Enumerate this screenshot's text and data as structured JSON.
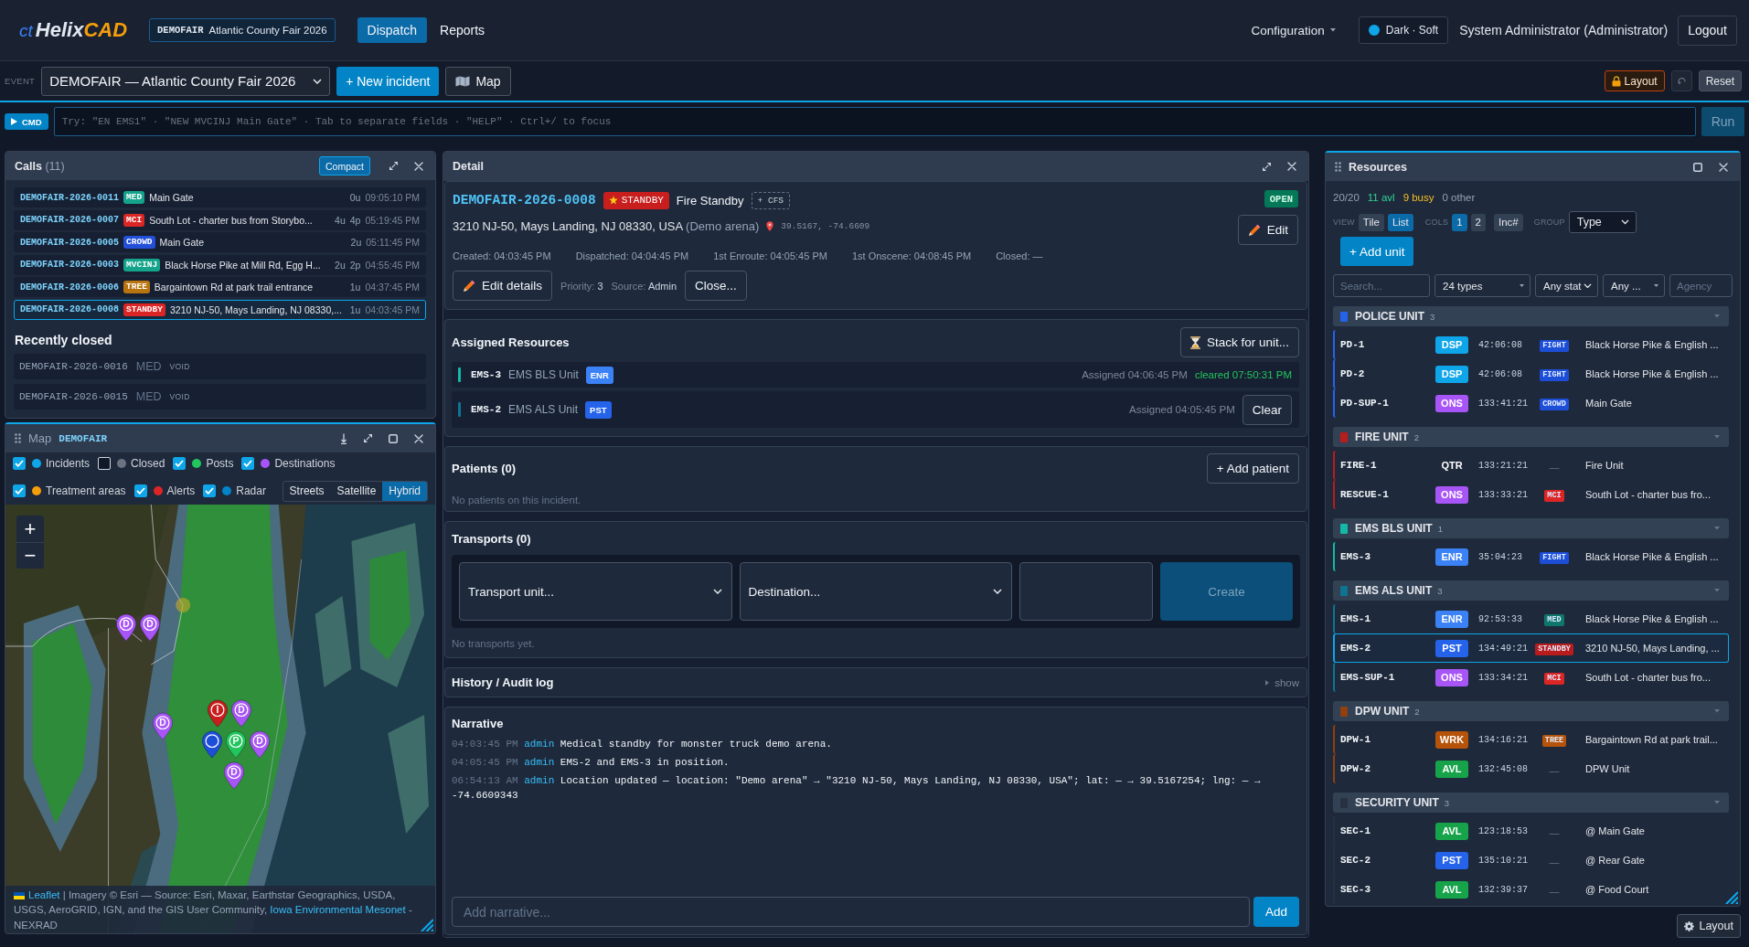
{
  "top_bar": {
    "logo": {
      "prefix": "ct",
      "name": "Helix",
      "suffix": "CAD"
    },
    "event_chip": {
      "code": "DEMOFAIR",
      "name": "Atlantic County Fair 2026"
    },
    "tabs": [
      {
        "label": "Dispatch",
        "selected": true
      },
      {
        "label": "Reports",
        "selected": false
      }
    ],
    "config_menu": "Configuration",
    "theme_toggle": "Dark · Soft",
    "user": "System Administrator (Administrator)",
    "logout": "Logout"
  },
  "event_bar": {
    "label": "EVENT",
    "event_select": "DEMOFAIR — Atlantic County Fair 2026",
    "new_incident": "+ New incident",
    "map": "Map",
    "layout": "Layout",
    "reset": "Reset"
  },
  "command_bar": {
    "button": "CMD",
    "placeholder": "Try: \"EN EMS1\" · \"NEW MVCINJ Main Gate\" · Tab to separate fields · \"HELP\" · Ctrl+/ to focus",
    "run": "Run"
  },
  "calls": {
    "title": "Calls",
    "count": "(11)",
    "compact": "Compact",
    "rows": [
      {
        "id": "DEMOFAIR-2026-0011",
        "type": {
          "label": "MED",
          "color": "#14a38b"
        },
        "location": "Main Gate",
        "units": "0u",
        "time": "09:05:10 PM",
        "selected": false
      },
      {
        "id": "DEMOFAIR-2026-0007",
        "type": {
          "label": "MCI",
          "color": "#dc2626"
        },
        "location": "South Lot - charter bus from Storybo...",
        "units": "4u",
        "patients": "4p",
        "time": "05:19:45 PM",
        "selected": false
      },
      {
        "id": "DEMOFAIR-2026-0005",
        "type": {
          "label": "CROWD",
          "color": "#2350d8"
        },
        "location": "Main Gate",
        "units": "2u",
        "time": "05:11:45 PM",
        "selected": false
      },
      {
        "id": "DEMOFAIR-2026-0003",
        "type": {
          "label": "MVCINJ",
          "color": "#14a38b"
        },
        "location": "Black Horse Pike at Mill Rd, Egg H...",
        "units": "2u",
        "patients": "2p",
        "time": "04:55:45 PM",
        "selected": false
      },
      {
        "id": "DEMOFAIR-2026-0006",
        "type": {
          "label": "TREE",
          "color": "#b8740f"
        },
        "location": "Bargaintown Rd at park trail entrance",
        "units": "1u",
        "time": "04:37:45 PM",
        "selected": false
      },
      {
        "id": "DEMOFAIR-2026-0008",
        "type": {
          "label": "STANDBY",
          "color": "#dc2626"
        },
        "location": "3210 NJ-50, Mays Landing, NJ 08330,...",
        "units": "1u",
        "time": "04:03:45 PM",
        "selected": true
      }
    ],
    "closed_title": "Recently closed",
    "closed": [
      {
        "id": "DEMOFAIR-2026-0016",
        "type": "MED",
        "status": "VOID"
      },
      {
        "id": "DEMOFAIR-2026-0015",
        "type": "MED",
        "status": "VOID"
      }
    ]
  },
  "map": {
    "title": "Map",
    "event": "DEMOFAIR",
    "layer_rows": [
      [
        {
          "label": "Incidents",
          "checked": true,
          "color": "#0ea5e9"
        },
        {
          "label": "Closed",
          "checked": false,
          "color": "#6b7280"
        },
        {
          "label": "Posts",
          "checked": true,
          "color": "#22c55e"
        },
        {
          "label": "Destinations",
          "checked": true,
          "color": "#a855f7"
        }
      ],
      [
        {
          "label": "Treatment areas",
          "checked": true,
          "color": "#f59e0b"
        },
        {
          "label": "Alerts",
          "checked": true,
          "color": "#dc2626"
        },
        {
          "label": "Radar",
          "checked": true,
          "color": "#0284c7"
        }
      ]
    ],
    "base_layers": [
      {
        "label": "Streets",
        "selected": false
      },
      {
        "label": "Satellite",
        "selected": false
      },
      {
        "label": "Hybrid",
        "selected": true
      }
    ],
    "zoom_in": "+",
    "zoom_out": "−",
    "markers": [
      {
        "label": "D",
        "color": "#a855f7"
      },
      {
        "label": "D",
        "color": "#a855f7"
      },
      {
        "label": "D",
        "color": "#a855f7"
      },
      {
        "label": "D",
        "color": "#a855f7"
      },
      {
        "label": "I",
        "color": "#c81e1e"
      },
      {
        "color": "#1d4ed8"
      },
      {
        "label": "P",
        "color": "#22c55e"
      },
      {
        "label": "D",
        "color": "#a855f7"
      },
      {
        "label": "D",
        "color": "#a855f7"
      }
    ],
    "attribution": {
      "leaflet": "Leaflet",
      "text": "| Imagery © Esri — Source: Esri, Maxar, Earthstar Geographics, USDA, USGS, AeroGRID, IGN, and the GIS User Community,",
      "source": "Iowa Environmental Mesonet",
      "suffix": "- NEXRAD"
    }
  },
  "detail": {
    "title": "Detail",
    "incident": {
      "id": "DEMOFAIR-2026-0008",
      "type": "STANDBY",
      "name": "Fire Standby",
      "cfs": "+ CFS",
      "status": "OPEN",
      "address": "3210 NJ-50, Mays Landing, NJ 08330, USA",
      "place": "(Demo arena)",
      "coords": "39.5167, -74.6609"
    },
    "edit": "Edit",
    "times": [
      "Created: 04:03:45 PM",
      "Dispatched: 04:04:45 PM",
      "1st Enroute: 04:05:45 PM",
      "1st Onscene: 04:08:45 PM",
      "Closed: —"
    ],
    "edit_details": "Edit details",
    "meta": [
      {
        "label": "Priority:",
        "value": "3"
      },
      {
        "label": "Source:",
        "value": "Admin"
      }
    ],
    "close": "Close...",
    "assigned": {
      "title": "Assigned Resources",
      "stack": "Stack for unit...",
      "rows": [
        {
          "unit": "EMS-3",
          "name": "EMS BLS Unit",
          "status": {
            "label": "ENR",
            "color": "#3b82f6"
          },
          "color": "#14b8a6",
          "assigned": "Assigned 04:06:45 PM",
          "cleared": "cleared 07:50:31 PM"
        },
        {
          "unit": "EMS-2",
          "name": "EMS ALS Unit",
          "status": {
            "label": "PST",
            "color": "#2563eb"
          },
          "color": "#0e7490",
          "assigned": "Assigned 04:05:45 PM",
          "action": "Clear"
        }
      ]
    },
    "patients": {
      "title": "Patients (0)",
      "add": "+ Add patient",
      "empty": "No patients on this incident."
    },
    "transports": {
      "title": "Transports (0)",
      "unit_select": "Transport unit...",
      "destination_select": "Destination...",
      "create": {
        "label": "Create",
        "disabled": true
      },
      "empty": "No transports yet."
    },
    "history": {
      "title": "History / Audit log",
      "toggle": "show",
      "expanded": false
    },
    "narrative": {
      "title": "Narrative",
      "entries": [
        {
          "time": "04:03:45 PM",
          "user": "admin",
          "text": "Medical standby for monster truck demo arena."
        },
        {
          "time": "04:05:45 PM",
          "user": "admin",
          "text": "EMS-2 and EMS-3 in position."
        },
        {
          "time": "06:54:13 AM",
          "user": "admin",
          "text": "Location updated — location: \"Demo arena\" → \"3210 NJ-50, Mays Landing, NJ 08330, USA\"; lat: — → 39.5167254; lng: — → -74.6609343"
        }
      ],
      "placeholder": "Add narrative...",
      "add": "Add"
    }
  },
  "resources": {
    "title": "Resources",
    "summary": {
      "total": "20/20",
      "available": "11 avl",
      "busy": "9 busy",
      "other": "0 other"
    },
    "view": {
      "label": "VIEW",
      "options": [
        {
          "label": "Tile",
          "selected": false
        },
        {
          "label": "List",
          "selected": true
        }
      ]
    },
    "cols": {
      "label": "COLS",
      "options": [
        {
          "label": "1",
          "selected": true
        },
        {
          "label": "2",
          "selected": false
        }
      ]
    },
    "inc_toggle": "Inc#",
    "group": {
      "label": "GROUP",
      "value": "Type"
    },
    "add_unit": "+ Add unit",
    "filters": [
      {
        "kind": "input",
        "placeholder": "Search..."
      },
      {
        "kind": "dropdown",
        "value": "24 types"
      },
      {
        "kind": "select",
        "value": "Any stat"
      },
      {
        "kind": "dropdown",
        "value": "Any ..."
      },
      {
        "kind": "input",
        "placeholder": "Agency"
      }
    ],
    "groups": [
      {
        "name": "POLICE UNIT",
        "count": "3",
        "color": "#2563eb",
        "units": [
          {
            "id": "PD-1",
            "status": {
              "label": "DSP",
              "color": "#0ea5e9"
            },
            "elapsed": "42:06:08",
            "incident": {
              "label": "FIGHT",
              "color": "#1d4ed8"
            },
            "location": "Black Horse Pike & English ...",
            "selected": false
          },
          {
            "id": "PD-2",
            "status": {
              "label": "DSP",
              "color": "#0ea5e9"
            },
            "elapsed": "42:06:08",
            "incident": {
              "label": "FIGHT",
              "color": "#1d4ed8"
            },
            "location": "Black Horse Pike & English ...",
            "selected": false
          },
          {
            "id": "PD-SUP-1",
            "status": {
              "label": "ONS",
              "color": "#a855f7"
            },
            "elapsed": "133:41:21",
            "incident": {
              "label": "CROWD",
              "color": "#1d4ed8"
            },
            "location": "Main Gate",
            "selected": false
          }
        ]
      },
      {
        "name": "FIRE UNIT",
        "count": "2",
        "color": "#b91c1c",
        "units": [
          {
            "id": "FIRE-1",
            "status": {
              "label": "QTR"
            },
            "elapsed": "133:21:21",
            "incident": {
              "label": "—"
            },
            "location": "Fire Unit",
            "selected": false
          },
          {
            "id": "RESCUE-1",
            "status": {
              "label": "ONS",
              "color": "#a855f7"
            },
            "elapsed": "133:33:21",
            "incident": {
              "label": "MCI",
              "color": "#dc2626"
            },
            "location": "South Lot - charter bus fro...",
            "selected": false
          }
        ]
      },
      {
        "name": "EMS BLS UNIT",
        "count": "1",
        "color": "#14b8a6",
        "units": [
          {
            "id": "EMS-3",
            "status": {
              "label": "ENR",
              "color": "#3b82f6"
            },
            "elapsed": "35:04:23",
            "incident": {
              "label": "FIGHT",
              "color": "#1d4ed8"
            },
            "location": "Black Horse Pike & English ...",
            "selected": false
          }
        ]
      },
      {
        "name": "EMS ALS UNIT",
        "count": "3",
        "color": "#0e7490",
        "units": [
          {
            "id": "EMS-1",
            "status": {
              "label": "ENR",
              "color": "#3b82f6"
            },
            "elapsed": "92:53:33",
            "incident": {
              "label": "MED",
              "color": "#0f766e"
            },
            "location": "Black Horse Pike & English ...",
            "selected": false
          },
          {
            "id": "EMS-2",
            "status": {
              "label": "PST",
              "color": "#2563eb"
            },
            "elapsed": "134:49:21",
            "incident": {
              "label": "STANDBY",
              "color": "#b91c1c"
            },
            "location": "3210 NJ-50, Mays Landing, ...",
            "selected": true
          },
          {
            "id": "EMS-SUP-1",
            "status": {
              "label": "ONS",
              "color": "#a855f7"
            },
            "elapsed": "133:34:21",
            "incident": {
              "label": "MCI",
              "color": "#dc2626"
            },
            "location": "South Lot - charter bus fro...",
            "selected": false
          }
        ]
      },
      {
        "name": "DPW UNIT",
        "count": "2",
        "color": "#92400e",
        "units": [
          {
            "id": "DPW-1",
            "status": {
              "label": "WRK",
              "color": "#b45309"
            },
            "elapsed": "134:16:21",
            "incident": {
              "label": "TREE",
              "color": "#b45309"
            },
            "location": "Bargaintown Rd at park trail...",
            "selected": false
          },
          {
            "id": "DPW-2",
            "status": {
              "label": "AVL",
              "color": "#16a34a"
            },
            "elapsed": "132:45:08",
            "incident": {
              "label": "—"
            },
            "location": "DPW Unit",
            "selected": false
          }
        ]
      },
      {
        "name": "SECURITY UNIT",
        "count": "3",
        "color": "#273142",
        "units": [
          {
            "id": "SEC-1",
            "status": {
              "label": "AVL",
              "color": "#16a34a"
            },
            "elapsed": "123:18:53",
            "incident": {
              "label": "—"
            },
            "location": "@ Main Gate",
            "selected": false
          },
          {
            "id": "SEC-2",
            "status": {
              "label": "PST",
              "color": "#2563eb"
            },
            "elapsed": "135:10:21",
            "incident": {
              "label": "—"
            },
            "location": "@ Rear Gate",
            "selected": false
          },
          {
            "id": "SEC-3",
            "status": {
              "label": "AVL",
              "color": "#16a34a"
            },
            "elapsed": "132:39:37",
            "incident": {
              "label": "—"
            },
            "location": "@ Food Court",
            "selected": false
          }
        ]
      }
    ]
  },
  "footer": {
    "layout": "Layout"
  }
}
